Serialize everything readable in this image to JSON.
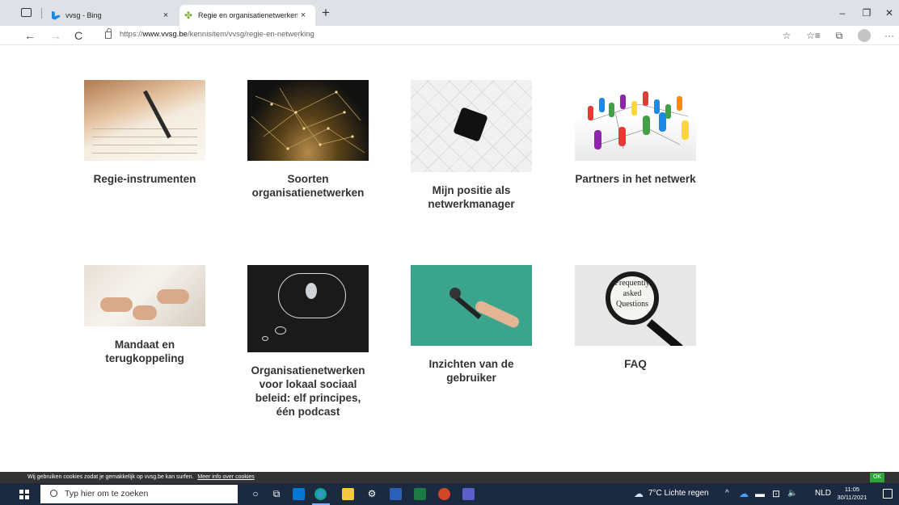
{
  "browser": {
    "tabs": [
      {
        "title": "vvsg - Bing",
        "favicon": "bing-icon",
        "active": false
      },
      {
        "title": "Regie en organisatienetwerken",
        "favicon": "vvsg-leaf-icon",
        "active": true
      }
    ],
    "close_glyph": "×",
    "new_tab_glyph": "+",
    "window_controls": {
      "minimize": "–",
      "restore": "❐",
      "close": "✕"
    },
    "nav": {
      "back": "←",
      "forward": "→",
      "refresh": "C"
    },
    "url": {
      "prefix": "https://",
      "domain": "www.vvsg.be",
      "path": "/kennisitem/vvsg/regie-en-netwerking"
    },
    "toolbar_icons": {
      "favorite_add": "☆",
      "favorites": "☆≡",
      "collections": "⧉",
      "more": "···"
    }
  },
  "cards": [
    {
      "label": "Regie-instrumenten",
      "image": "hand-writing-image"
    },
    {
      "label": "Soorten organisatienetwerken",
      "image": "dew-network-image"
    },
    {
      "label": "Mijn positie als netwerkmanager",
      "image": "puzzle-image"
    },
    {
      "label": "Partners in het netwerk",
      "image": "pawns-network-image"
    },
    {
      "label": "Mandaat en terugkoppeling",
      "image": "desk-meeting-image"
    },
    {
      "label": "Organisatienetwerken voor lokaal sociaal beleid: elf principes, één podcast",
      "image": "lightbulb-chalk-image"
    },
    {
      "label": "Inzichten van de gebruiker",
      "image": "microphone-image"
    },
    {
      "label": "FAQ",
      "image": "magnifier-faq-image",
      "image_text": "Frequently asked Questions"
    }
  ],
  "cookie_bar": {
    "text": "Wij gebruiken cookies zodat je gemakkelijk op vvsg.be kan surfen.",
    "link": "Meer info over cookies",
    "ok": "OK"
  },
  "taskbar": {
    "search_placeholder": "Typ hier om te zoeken",
    "weather": "7°C  Lichte regen",
    "language": "NLD",
    "time": "11:05",
    "date": "30/11/2021",
    "tray_chevron": "^",
    "volume": "🔈"
  },
  "colors": {
    "tabbar": "#dee1e6",
    "cookie_bar": "#333333",
    "ok_button": "#2ca53a",
    "taskbar": "#1b2a40",
    "mic_bg": "#3aa58c"
  }
}
